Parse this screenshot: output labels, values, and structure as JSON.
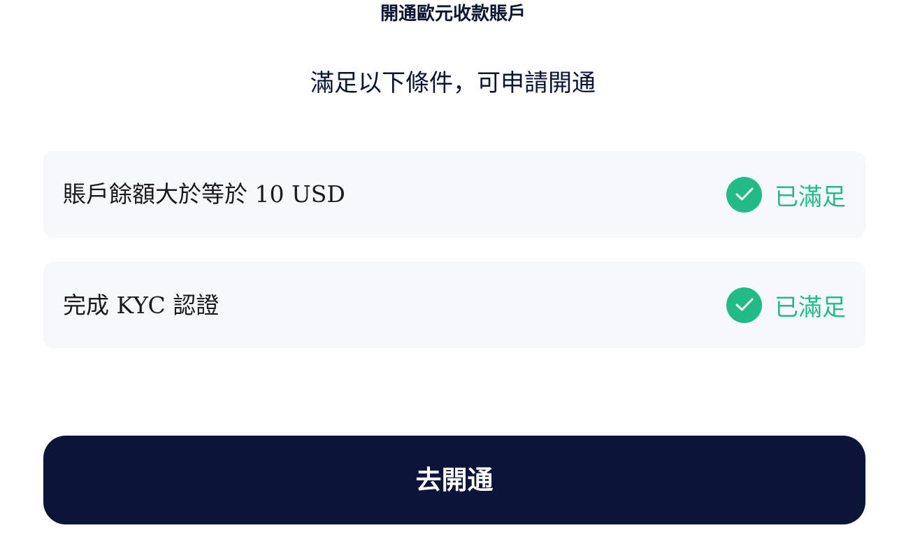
{
  "header": {
    "title": "開通歐元收款賬戶"
  },
  "main": {
    "subtitle": "滿足以下條件，可申請開通",
    "conditions": [
      {
        "label": "賬戶餘額大於等於 10 USD",
        "status": "已滿足",
        "icon": "check-circle-icon"
      },
      {
        "label": "完成 KYC 認證",
        "status": "已滿足",
        "icon": "check-circle-icon"
      }
    ],
    "button_label": "去開通"
  },
  "colors": {
    "primary_dark": "#0a1537",
    "success_green": "#22bb88",
    "card_background": "#f6f8fc",
    "text_dark": "#0b1533"
  }
}
